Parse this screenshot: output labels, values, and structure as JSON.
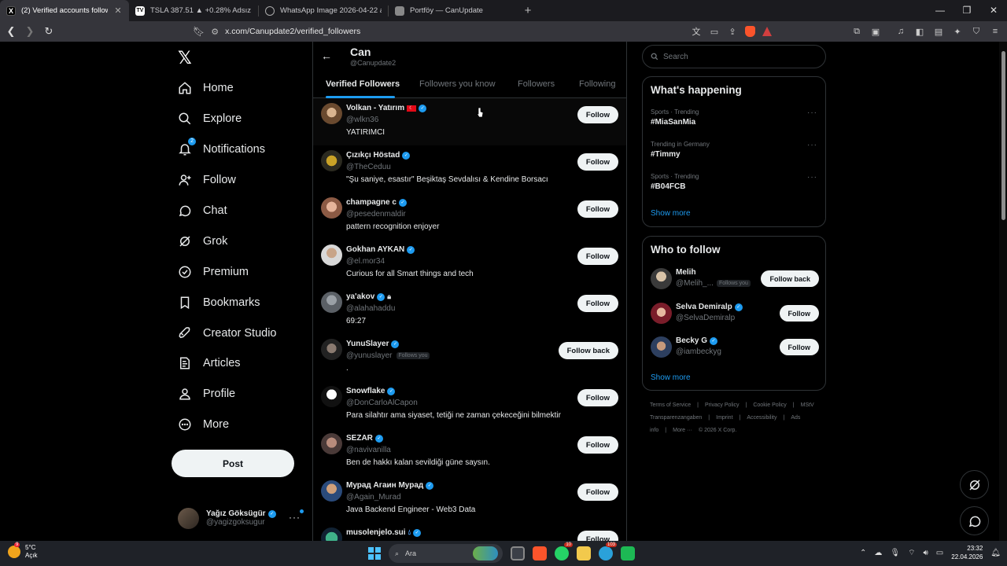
{
  "browser": {
    "tabs": [
      {
        "title": "(2) Verified accounts following C",
        "favicon": "X",
        "active": true
      },
      {
        "title": "TSLA 387.51 ▲ +0.28% Adsız",
        "favicon": "TV",
        "active": false
      },
      {
        "title": "WhatsApp Image 2026-04-22 at 22.3",
        "favicon": "globe",
        "active": false
      },
      {
        "title": "Portföy — CanUpdate",
        "favicon": "doc",
        "active": false
      }
    ],
    "url": "x.com/Canupdate2/verified_followers",
    "brave_badge": "1"
  },
  "nav": {
    "items": [
      {
        "label": "Home",
        "icon": "home-icon"
      },
      {
        "label": "Explore",
        "icon": "search-icon"
      },
      {
        "label": "Notifications",
        "icon": "bell-icon",
        "badge": "2"
      },
      {
        "label": "Follow",
        "icon": "person-plus-icon"
      },
      {
        "label": "Chat",
        "icon": "chat-icon"
      },
      {
        "label": "Grok",
        "icon": "grok-icon"
      },
      {
        "label": "Premium",
        "icon": "verified-icon"
      },
      {
        "label": "Bookmarks",
        "icon": "bookmark-icon"
      },
      {
        "label": "Creator Studio",
        "icon": "rocket-icon"
      },
      {
        "label": "Articles",
        "icon": "article-icon"
      },
      {
        "label": "Profile",
        "icon": "person-icon"
      },
      {
        "label": "More",
        "icon": "more-circle-icon"
      }
    ],
    "post_label": "Post",
    "account": {
      "name": "Yağız Göksügür",
      "handle": "@yagizgoksugur"
    }
  },
  "profile_header": {
    "name": "Can",
    "handle": "@Canupdate2"
  },
  "tabs": [
    "Verified Followers",
    "Followers you know",
    "Followers",
    "Following"
  ],
  "followers": [
    {
      "name": "Volkan - Yatırım",
      "flag": true,
      "handle": "@wlkn36",
      "bio": "YATIRIMCI",
      "button": "Follow"
    },
    {
      "name": "Çızıkçı Höstad",
      "handle": "@TheCeduu",
      "bio": "\"Şu saniye, esastır\" Beşiktaş Sevdalısı & Kendine Borsacı",
      "button": "Follow"
    },
    {
      "name": "champagne c",
      "handle": "@pesedenmaldir",
      "bio": "pattern recognition enjoyer",
      "button": "Follow"
    },
    {
      "name": "Gokhan AYKAN",
      "handle": "@el.mor34",
      "bio": "Curious for all Smart things and tech",
      "button": "Follow"
    },
    {
      "name": "ya'akov",
      "lock": true,
      "handle": "@alahahaddu",
      "bio": "69:27",
      "button": "Follow"
    },
    {
      "name": "YunuSlayer",
      "handle": "@yunuslayer",
      "follows_you": "Follows you",
      "bio": ".",
      "button": "Follow back"
    },
    {
      "name": "Snowflake",
      "handle": "@DonCarloAlCapon",
      "bio": "Para silahtır ama siyaset, tetiği ne zaman çekeceğini bilmektir",
      "button": "Follow"
    },
    {
      "name": "SEZAR",
      "handle": "@navivanilla",
      "bio": "Ben de hakkı kalan sevildiği güne saysın.",
      "button": "Follow"
    },
    {
      "name": "Мурад Агаин Мурад",
      "handle": "@Again_Murad",
      "bio": "Java Backend Engineer - Web3 Data",
      "button": "Follow"
    },
    {
      "name": "musolenjelo.sui",
      "drop": true,
      "handle": "",
      "bio": "",
      "button": "Follow"
    }
  ],
  "search": {
    "placeholder": "Search"
  },
  "happening": {
    "title": "What's happening",
    "trends": [
      {
        "context": "Sports · Trending",
        "tag": "#MiaSanMia"
      },
      {
        "context": "Trending in Germany",
        "tag": "#Timmy"
      },
      {
        "context": "Sports · Trending",
        "tag": "#B04FCB"
      }
    ],
    "show_more": "Show more"
  },
  "who_to_follow": {
    "title": "Who to follow",
    "users": [
      {
        "name": "Melih",
        "handle": "@Melih_...",
        "follows_you": "Follows you",
        "button": "Follow back"
      },
      {
        "name": "Selva Demiralp",
        "handle": "@SelvaDemiralp",
        "button": "Follow"
      },
      {
        "name": "Becky G",
        "handle": "@iambeckyg",
        "button": "Follow"
      }
    ],
    "show_more": "Show more"
  },
  "footer": {
    "links": [
      "Terms of Service",
      "|",
      "Privacy Policy",
      "|",
      "Cookie Policy",
      "|",
      "MStV Transparenzangaben",
      "|",
      "Imprint",
      "|",
      "Accessibility",
      "|",
      "Ads info",
      "|",
      "More ···",
      "© 2026 X Corp."
    ]
  },
  "taskbar": {
    "weather_temp": "5°C",
    "weather_desc": "Açık",
    "weather_badge": "9",
    "search_placeholder": "Ara",
    "time": "23:32",
    "date": "22.04.2026",
    "badges": {
      "whatsapp": "10",
      "telegram": "103"
    }
  },
  "colors": {
    "accent": "#1d9bf0",
    "background": "#000000",
    "border": "#2f3336",
    "muted": "#71767b"
  }
}
